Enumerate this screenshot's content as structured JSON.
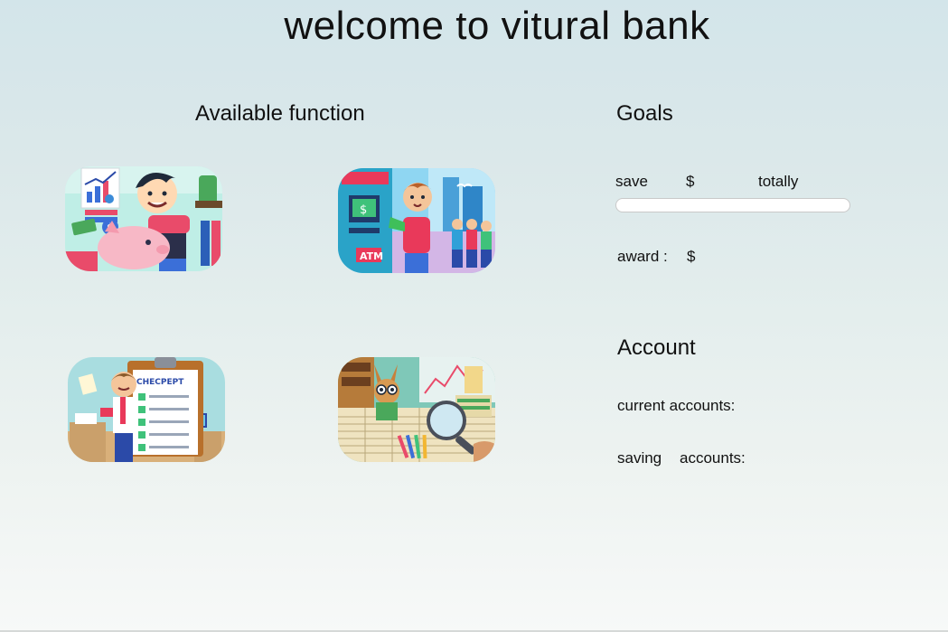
{
  "page": {
    "title": "welcome to vitural bank"
  },
  "functions": {
    "heading": "Available function",
    "tiles": [
      {
        "name": "savings-piggy-bank",
        "icon": "piggy-bank-illustration"
      },
      {
        "name": "atm-withdrawal",
        "icon": "atm-illustration",
        "sign_text": "ATM"
      },
      {
        "name": "checklist",
        "icon": "checklist-illustration",
        "sign_text": "CHECPEPT"
      },
      {
        "name": "financial-analysis",
        "icon": "magnifier-illustration"
      }
    ]
  },
  "goals": {
    "heading": "Goals",
    "save_label": "save",
    "save_currency": "$",
    "totally_label": "totally",
    "progress": 0,
    "award_label": "award :",
    "award_currency": "$"
  },
  "account": {
    "heading": "Account",
    "current_label": "current accounts:",
    "saving_label_1": "saving",
    "saving_label_2": "accounts:"
  },
  "colors": {
    "background_top": "#d3e5ea",
    "background_bottom": "#f7f9f8",
    "text": "#111111",
    "progress_track": "#ffffff"
  }
}
